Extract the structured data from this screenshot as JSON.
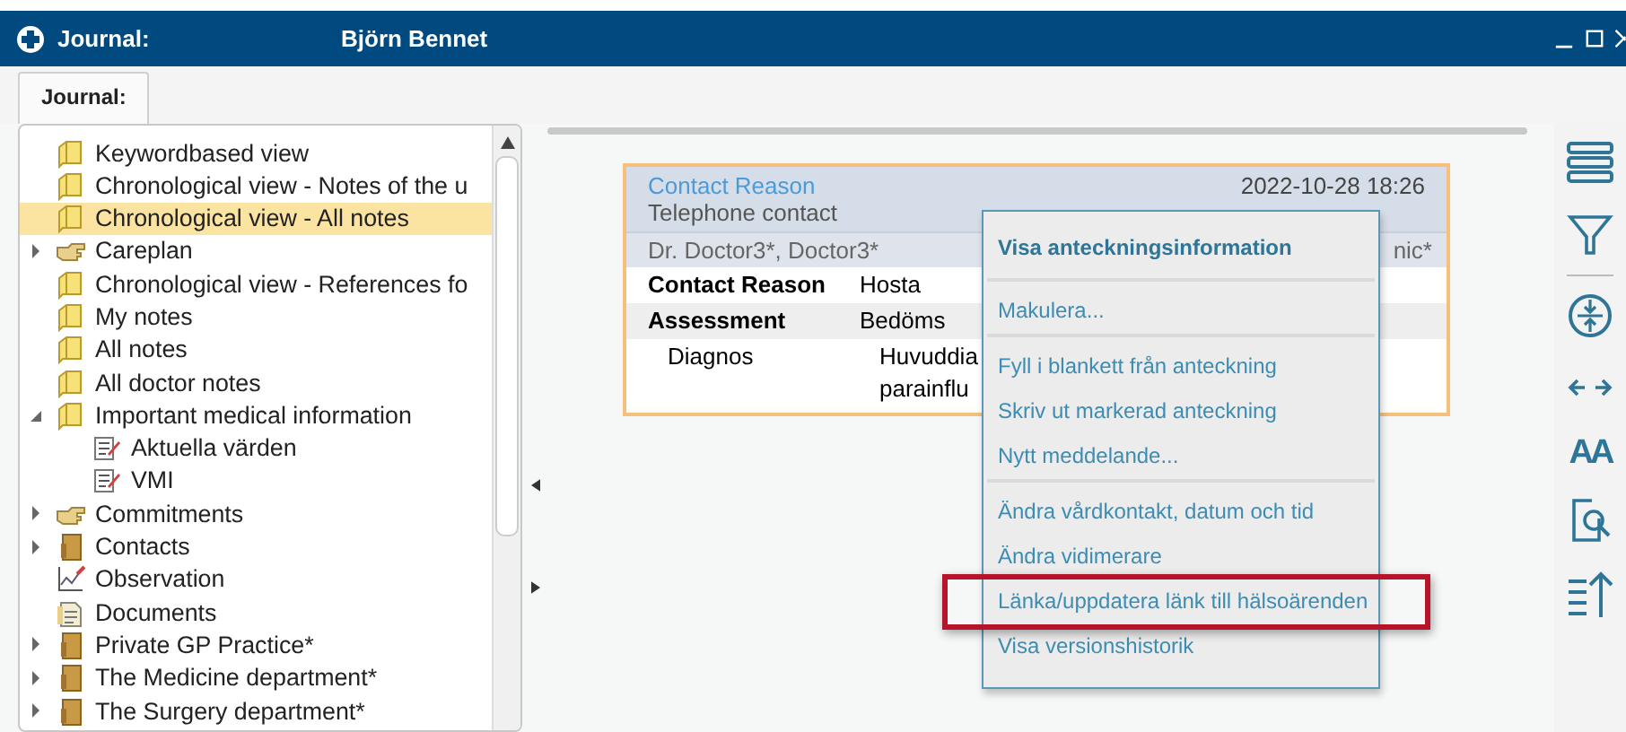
{
  "window": {
    "title": "Journal:",
    "patient": "Björn Bennet"
  },
  "tabs": [
    {
      "label": "Journal:",
      "selected": true
    }
  ],
  "tree": [
    {
      "label": "Keywordbased view",
      "kind": "note-folder",
      "selected": false
    },
    {
      "label": "Chronological view - Notes of the u",
      "kind": "note-folder",
      "selected": false
    },
    {
      "label": "Chronological view - All notes",
      "kind": "note-folder",
      "selected": true
    },
    {
      "label": "Careplan",
      "kind": "hand",
      "selected": false,
      "expanded": false
    },
    {
      "label": "Chronological view - References fo",
      "kind": "note-folder",
      "selected": false
    },
    {
      "label": "My notes",
      "kind": "note-folder",
      "selected": false
    },
    {
      "label": "All notes",
      "kind": "note-folder",
      "selected": false
    },
    {
      "label": "All doctor notes",
      "kind": "note-folder",
      "selected": false
    },
    {
      "label": "Important medical information",
      "kind": "note-folder",
      "selected": false,
      "expanded": true,
      "children": [
        {
          "label": "Aktuella värden",
          "kind": "form",
          "selected": false
        },
        {
          "label": "VMI",
          "kind": "form",
          "selected": false
        }
      ]
    },
    {
      "label": "Commitments",
      "kind": "hand",
      "selected": false,
      "expanded": false
    },
    {
      "label": "Contacts",
      "kind": "binder",
      "selected": false,
      "expanded": false
    },
    {
      "label": "Observation",
      "kind": "chart",
      "selected": false
    },
    {
      "label": "Documents",
      "kind": "document",
      "selected": false
    },
    {
      "label": "Private GP Practice*",
      "kind": "binder",
      "selected": false,
      "expanded": false
    },
    {
      "label": "The Medicine department*",
      "kind": "binder",
      "selected": false,
      "expanded": false
    },
    {
      "label": "The Surgery department*",
      "kind": "binder",
      "selected": false,
      "expanded": false
    }
  ],
  "note": {
    "title": "Contact Reason",
    "subtitle": "Telephone contact",
    "datetime": "2022-10-28 18:26",
    "authors": "Dr. Doctor3*, Doctor3*",
    "unit": "nic*",
    "rows": [
      {
        "label": "Contact Reason",
        "value": [
          "Hosta"
        ],
        "kind": "item"
      },
      {
        "label": "Assessment",
        "value": [
          "Bedöms"
        ],
        "kind": "section"
      },
      {
        "label": "Diagnos",
        "value": [
          "Huvuddia",
          "parainflu"
        ],
        "kind": "sub"
      }
    ]
  },
  "context_menu": [
    {
      "kind": "header",
      "label": "Visa anteckningsinformation"
    },
    {
      "kind": "separator"
    },
    {
      "kind": "item",
      "label": "Makulera..."
    },
    {
      "kind": "separator"
    },
    {
      "kind": "item",
      "label": "Fyll i blankett från anteckning"
    },
    {
      "kind": "item",
      "label": "Skriv ut markerad anteckning"
    },
    {
      "kind": "item",
      "label": "Nytt meddelande..."
    },
    {
      "kind": "separator"
    },
    {
      "kind": "item",
      "label": "Ändra vårdkontakt, datum och tid"
    },
    {
      "kind": "item",
      "label": "Ändra vidimerare"
    },
    {
      "kind": "item",
      "label": "Länka/uppdatera länk till hälsoärenden",
      "highlighted": true
    },
    {
      "kind": "item",
      "label": "Visa versionshistorik"
    }
  ],
  "toolbar": [
    {
      "kind": "list"
    },
    {
      "kind": "filter"
    },
    {
      "kind": "separator"
    },
    {
      "kind": "compress"
    },
    {
      "kind": "width"
    },
    {
      "kind": "font",
      "label": "AA"
    },
    {
      "kind": "preview"
    },
    {
      "kind": "sort"
    }
  ]
}
